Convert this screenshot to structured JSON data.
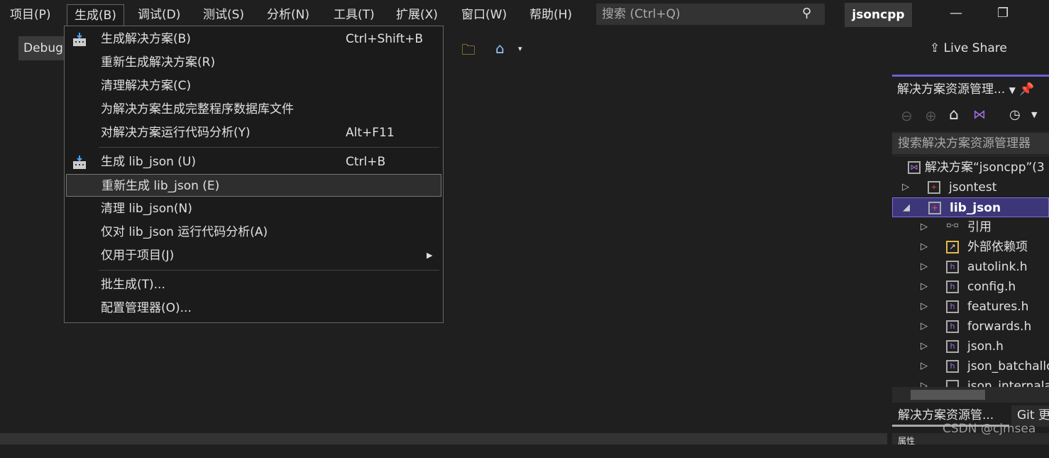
{
  "menubar": {
    "items": [
      "项目(P)",
      "生成(B)",
      "调试(D)",
      "测试(S)",
      "分析(N)",
      "工具(T)",
      "扩展(X)",
      "窗口(W)",
      "帮助(H)"
    ],
    "search_placeholder": "搜索 (Ctrl+Q)",
    "project_name": "jsoncpp"
  },
  "toolbar": {
    "config": "Debug",
    "live_share": "Live Share"
  },
  "build_menu": {
    "items": [
      {
        "label": "生成解决方案(B)",
        "shortcut": "Ctrl+Shift+B",
        "icon": "build-icon"
      },
      {
        "label": "重新生成解决方案(R)",
        "shortcut": ""
      },
      {
        "label": "清理解决方案(C)",
        "shortcut": ""
      },
      {
        "label": "为解决方案生成完整程序数据库文件",
        "shortcut": ""
      },
      {
        "label": "对解决方案运行代码分析(Y)",
        "shortcut": "Alt+F11"
      },
      {
        "label": "生成 lib_json (U)",
        "shortcut": "Ctrl+B",
        "icon": "build-icon"
      },
      {
        "label": "重新生成 lib_json (E)",
        "shortcut": "",
        "highlighted": true
      },
      {
        "label": "清理 lib_json(N)",
        "shortcut": ""
      },
      {
        "label": "仅对 lib_json 运行代码分析(A)",
        "shortcut": ""
      },
      {
        "label": "仅用于项目(J)",
        "shortcut": "",
        "submenu": true
      },
      {
        "label": "批生成(T)...",
        "shortcut": ""
      },
      {
        "label": "配置管理器(O)...",
        "shortcut": ""
      }
    ]
  },
  "solution_explorer": {
    "title": "解决方案资源管理...",
    "search_placeholder": "搜索解决方案资源管理器",
    "tree": [
      {
        "label": "解决方案“jsoncpp”(3",
        "level": 0
      },
      {
        "label": "jsontest",
        "level": 1,
        "expander": "▷"
      },
      {
        "label": "lib_json",
        "level": 1,
        "expander": "◢",
        "selected": true
      },
      {
        "label": "引用",
        "level": 2,
        "expander": "▷"
      },
      {
        "label": "外部依赖项",
        "level": 2,
        "expander": "▷"
      },
      {
        "label": "autolink.h",
        "level": 2,
        "expander": "▷"
      },
      {
        "label": "config.h",
        "level": 2,
        "expander": "▷"
      },
      {
        "label": "features.h",
        "level": 2,
        "expander": "▷"
      },
      {
        "label": "forwards.h",
        "level": 2,
        "expander": "▷"
      },
      {
        "label": "json.h",
        "level": 2,
        "expander": "▷"
      },
      {
        "label": "json_batchallo",
        "level": 2,
        "expander": "▷"
      },
      {
        "label": "json_internala",
        "level": 2,
        "expander": "▷"
      }
    ],
    "tabs": [
      "解决方案资源管...",
      "Git 更"
    ],
    "bottom_label": "属性"
  },
  "watermark": "CSDN @cjmsea",
  "colors": {
    "accent": "#6b5fd0",
    "selection": "#3d3779",
    "header_icon": "#e44444"
  }
}
